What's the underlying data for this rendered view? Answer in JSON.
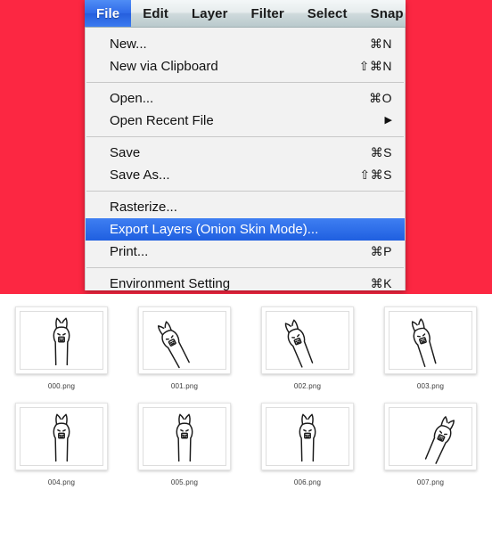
{
  "colors": {
    "backdrop_red": "#FC2742",
    "menu_highlight_blue": "#2F6AE8",
    "menu_background": "#F2F2F2",
    "panel_white": "#FFFFFF"
  },
  "menubar": {
    "items": [
      {
        "label": "File",
        "active": true
      },
      {
        "label": "Edit",
        "active": false
      },
      {
        "label": "Layer",
        "active": false
      },
      {
        "label": "Filter",
        "active": false
      },
      {
        "label": "Select",
        "active": false
      },
      {
        "label": "Snap",
        "active": false
      }
    ]
  },
  "file_menu": {
    "groups": [
      {
        "rows": [
          {
            "label": "New...",
            "shortcut": "⌘N",
            "arrow": "",
            "selected": false
          },
          {
            "label": "New via Clipboard",
            "shortcut": "⇧⌘N",
            "arrow": "",
            "selected": false
          }
        ]
      },
      {
        "rows": [
          {
            "label": "Open...",
            "shortcut": "⌘O",
            "arrow": "",
            "selected": false
          },
          {
            "label": "Open Recent File",
            "shortcut": "",
            "arrow": "▶",
            "selected": false
          }
        ]
      },
      {
        "rows": [
          {
            "label": "Save",
            "shortcut": "⌘S",
            "arrow": "",
            "selected": false
          },
          {
            "label": "Save As...",
            "shortcut": "⇧⌘S",
            "arrow": "",
            "selected": false
          }
        ]
      },
      {
        "rows": [
          {
            "label": "Rasterize...",
            "shortcut": "",
            "arrow": "",
            "selected": false
          },
          {
            "label": "Export Layers (Onion Skin Mode)...",
            "shortcut": "",
            "arrow": "",
            "selected": true
          },
          {
            "label": "Print...",
            "shortcut": "⌘P",
            "arrow": "",
            "selected": false
          }
        ]
      },
      {
        "rows": [
          {
            "label": "Environment Setting",
            "shortcut": "⌘K",
            "arrow": "",
            "selected": false
          }
        ]
      }
    ]
  },
  "files_panel": {
    "rows": [
      [
        {
          "name": "000.png",
          "icon": "alpaca-thumbnail",
          "tilt": 0
        },
        {
          "name": "001.png",
          "icon": "alpaca-thumbnail",
          "tilt": -24
        },
        {
          "name": "002.png",
          "icon": "alpaca-thumbnail",
          "tilt": -20
        },
        {
          "name": "003.png",
          "icon": "alpaca-thumbnail",
          "tilt": -16
        }
      ],
      [
        {
          "name": "004.png",
          "icon": "alpaca-thumbnail",
          "tilt": 0
        },
        {
          "name": "005.png",
          "icon": "alpaca-thumbnail",
          "tilt": 0
        },
        {
          "name": "006.png",
          "icon": "alpaca-thumbnail",
          "tilt": 0
        },
        {
          "name": "007.png",
          "icon": "alpaca-thumbnail",
          "tilt": 22
        }
      ]
    ]
  }
}
